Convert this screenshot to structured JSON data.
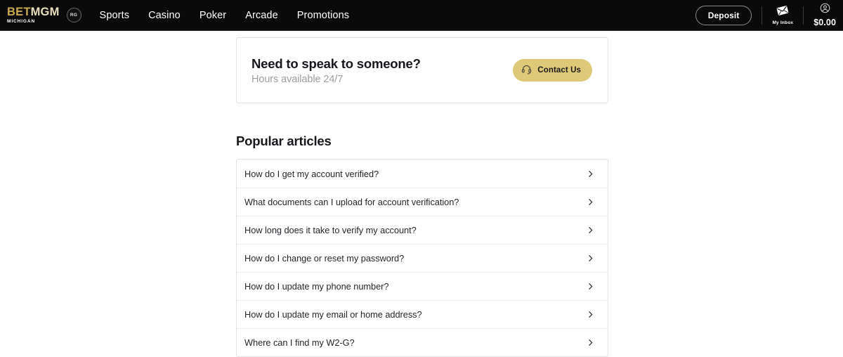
{
  "header": {
    "logo": {
      "bet": "BET",
      "mgm": "MGM",
      "state": "MICHIGAN",
      "rg_badge": "RG"
    },
    "nav": [
      {
        "label": "Sports"
      },
      {
        "label": "Casino"
      },
      {
        "label": "Poker"
      },
      {
        "label": "Arcade"
      },
      {
        "label": "Promotions"
      }
    ],
    "deposit_label": "Deposit",
    "inbox_label": "My Inbox",
    "balance": "$0.00",
    "colors": {
      "background": "#0a0a0a",
      "logo_gold": "#c8a951",
      "text": "#ffffff"
    }
  },
  "contact_card": {
    "title": "Need to speak to someone?",
    "subtitle": "Hours available 24/7",
    "button_label": "Contact Us",
    "button_color": "#dec979"
  },
  "popular_articles": {
    "heading": "Popular articles",
    "items": [
      {
        "label": "How do I get my account verified?"
      },
      {
        "label": "What documents can I upload for account verification?"
      },
      {
        "label": "How long does it take to verify my account?"
      },
      {
        "label": "How do I change or reset my password?"
      },
      {
        "label": "How do I update my phone number?"
      },
      {
        "label": "How do I update my email or home address?"
      },
      {
        "label": "Where can I find my W2-G?"
      }
    ]
  }
}
